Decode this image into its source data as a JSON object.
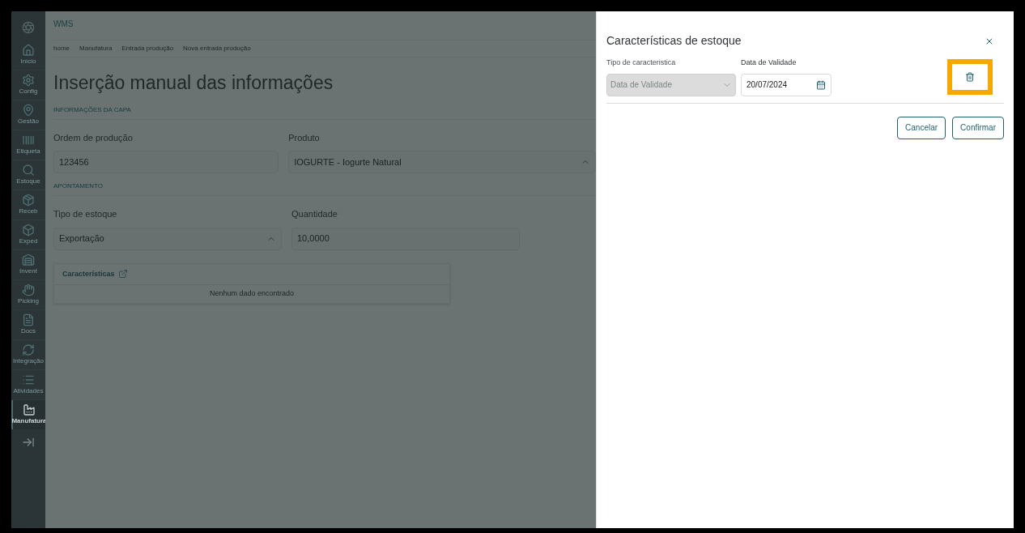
{
  "sidebar": {
    "items": [
      {
        "label": "Início",
        "selected": false
      },
      {
        "label": "Config",
        "selected": false
      },
      {
        "label": "Gestão",
        "selected": false
      },
      {
        "label": "Etiqueta",
        "selected": false
      },
      {
        "label": "Estoque",
        "selected": false
      },
      {
        "label": "Receb",
        "selected": false
      },
      {
        "label": "Exped",
        "selected": false
      },
      {
        "label": "Invent",
        "selected": false
      },
      {
        "label": "Picking",
        "selected": false
      },
      {
        "label": "Docs",
        "selected": false
      },
      {
        "label": "Integração",
        "selected": false
      },
      {
        "label": "Atividades",
        "selected": false
      },
      {
        "label": "Manufatura",
        "selected": true
      }
    ]
  },
  "app_title": "WMS",
  "breadcrumb": [
    "home",
    "Manufatura",
    "Entrada produção",
    "Nova entrada produção"
  ],
  "page_title": "Inserção manual das informações",
  "sections": [
    {
      "title": "INFORMAÇÕES DA CAPA",
      "fields": [
        {
          "label": "Ordem de produção",
          "value": "123456",
          "kind": "text"
        },
        {
          "label": "Produto",
          "value": "IOGURTE - Iogurte Natural",
          "kind": "select"
        }
      ]
    },
    {
      "title": "APONTAMENTO",
      "fields": [
        {
          "label": "Tipo de estoque",
          "value": "Exportação",
          "kind": "select"
        },
        {
          "label": "Quantidade",
          "value": "10,0000",
          "kind": "text"
        }
      ]
    }
  ],
  "characteristics_card": {
    "title": "Características",
    "empty_message": "Nenhum dado encontrado"
  },
  "drawer": {
    "title": "Características de estoque",
    "type_field": {
      "label": "Tipo de caracteristica",
      "value": "Data de Validade",
      "disabled": true
    },
    "date_field": {
      "label": "Data de Validade",
      "value": "20/07/2024"
    },
    "delete_highlighted": true,
    "buttons": [
      "Cancelar",
      "Confirmar"
    ]
  }
}
